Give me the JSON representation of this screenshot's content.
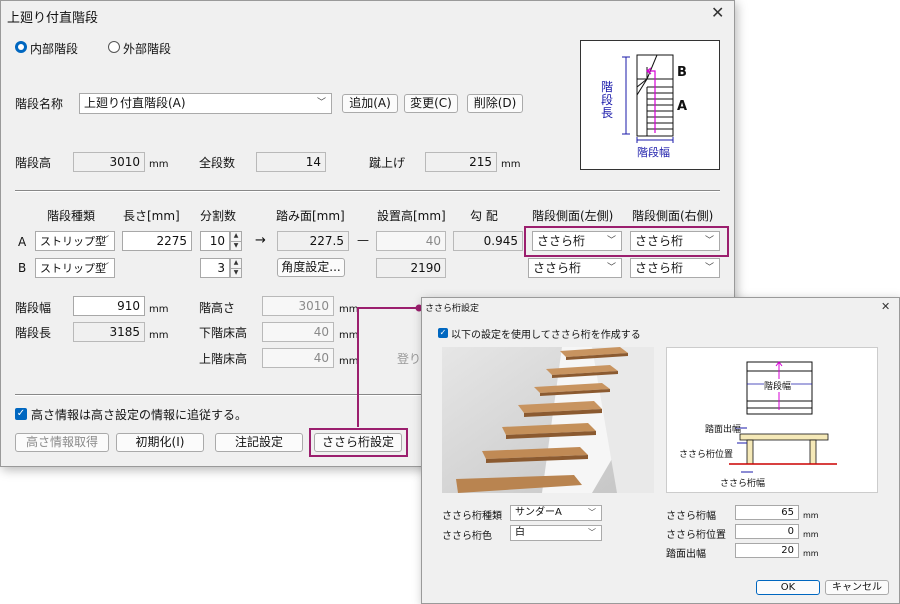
{
  "main_dialog": {
    "title": "上廻り付直階段",
    "radio_internal": "内部階段",
    "radio_external": "外部階段",
    "stair_name_label": "階段名称",
    "stair_name_value": "上廻り付直階段(A)",
    "add_button": "追加(A)",
    "change_button": "変更(C)",
    "delete_button": "削除(D)",
    "height_label": "階段高",
    "height_value": "3010",
    "steps_label": "全段数",
    "steps_value": "14",
    "riser_label": "蹴上げ",
    "riser_value": "215",
    "unit_mm": "mm",
    "headers": {
      "type": "階段種類",
      "length": "長さ[mm]",
      "divisions": "分割数",
      "tread": "踏み面[mm]",
      "install_height": "設置高[mm]",
      "slope": "勾 配",
      "side_left": "階段側面(左側)",
      "side_right": "階段側面(右側)"
    },
    "row_a": {
      "label": "A",
      "type": "ストリップ型",
      "length": "2275",
      "divisions": "10",
      "arrow": "→",
      "tread": "227.5",
      "dash": "—",
      "install_height": "40",
      "slope": "0.945",
      "side_left": "ささら桁",
      "side_right": "ささら桁"
    },
    "row_b": {
      "label": "B",
      "type": "ストリップ型",
      "divisions": "3",
      "angle_button": "角度設定...",
      "install_height": "2190",
      "side_left": "ささら桁",
      "side_right": "ささら桁"
    },
    "width_label": "階段幅",
    "width_value": "910",
    "length_label": "階段長",
    "length_value": "3185",
    "stair_height_label": "階高さ",
    "stair_height_value": "3010",
    "lower_floor_label": "下階床高",
    "lower_floor_value": "40",
    "upper_floor_label": "上階床高",
    "upper_floor_value": "40",
    "partial_text": "登り",
    "follow_checkbox": "高さ情報は高さ設定の情報に追従する。",
    "get_height_button": "高さ情報取得",
    "init_button": "初期化(I)",
    "note_button": "注記設定",
    "sasara_button": "ささら桁設定",
    "diagram": {
      "side_label": "階段長",
      "bottom_label": "階段幅",
      "a": "A",
      "b": "B"
    }
  },
  "sub_dialog": {
    "title": "ささら桁設定",
    "checkbox": "以下の設定を使用してささら桁を作成する",
    "type_label": "ささら桁種類",
    "type_value": "サンダーA",
    "color_label": "ささら桁色",
    "color_value": "白",
    "width_label": "ささら桁幅",
    "width_value": "65",
    "pos_label": "ささら桁位置",
    "pos_value": "0",
    "tread_out_label": "踏面出幅",
    "tread_out_value": "20",
    "unit": "mm",
    "ok_button": "OK",
    "cancel_button": "キャンセル",
    "diagram": {
      "stair_width": "階段幅",
      "tread_out": "踏面出幅",
      "pos": "ささら桁位置",
      "width": "ささら桁幅"
    }
  },
  "colors": {
    "accent": "#0067c0",
    "highlight": "#9b1f6e",
    "diagram_blue": "#1a1aaa",
    "diagram_magenta": "#d400d4"
  }
}
